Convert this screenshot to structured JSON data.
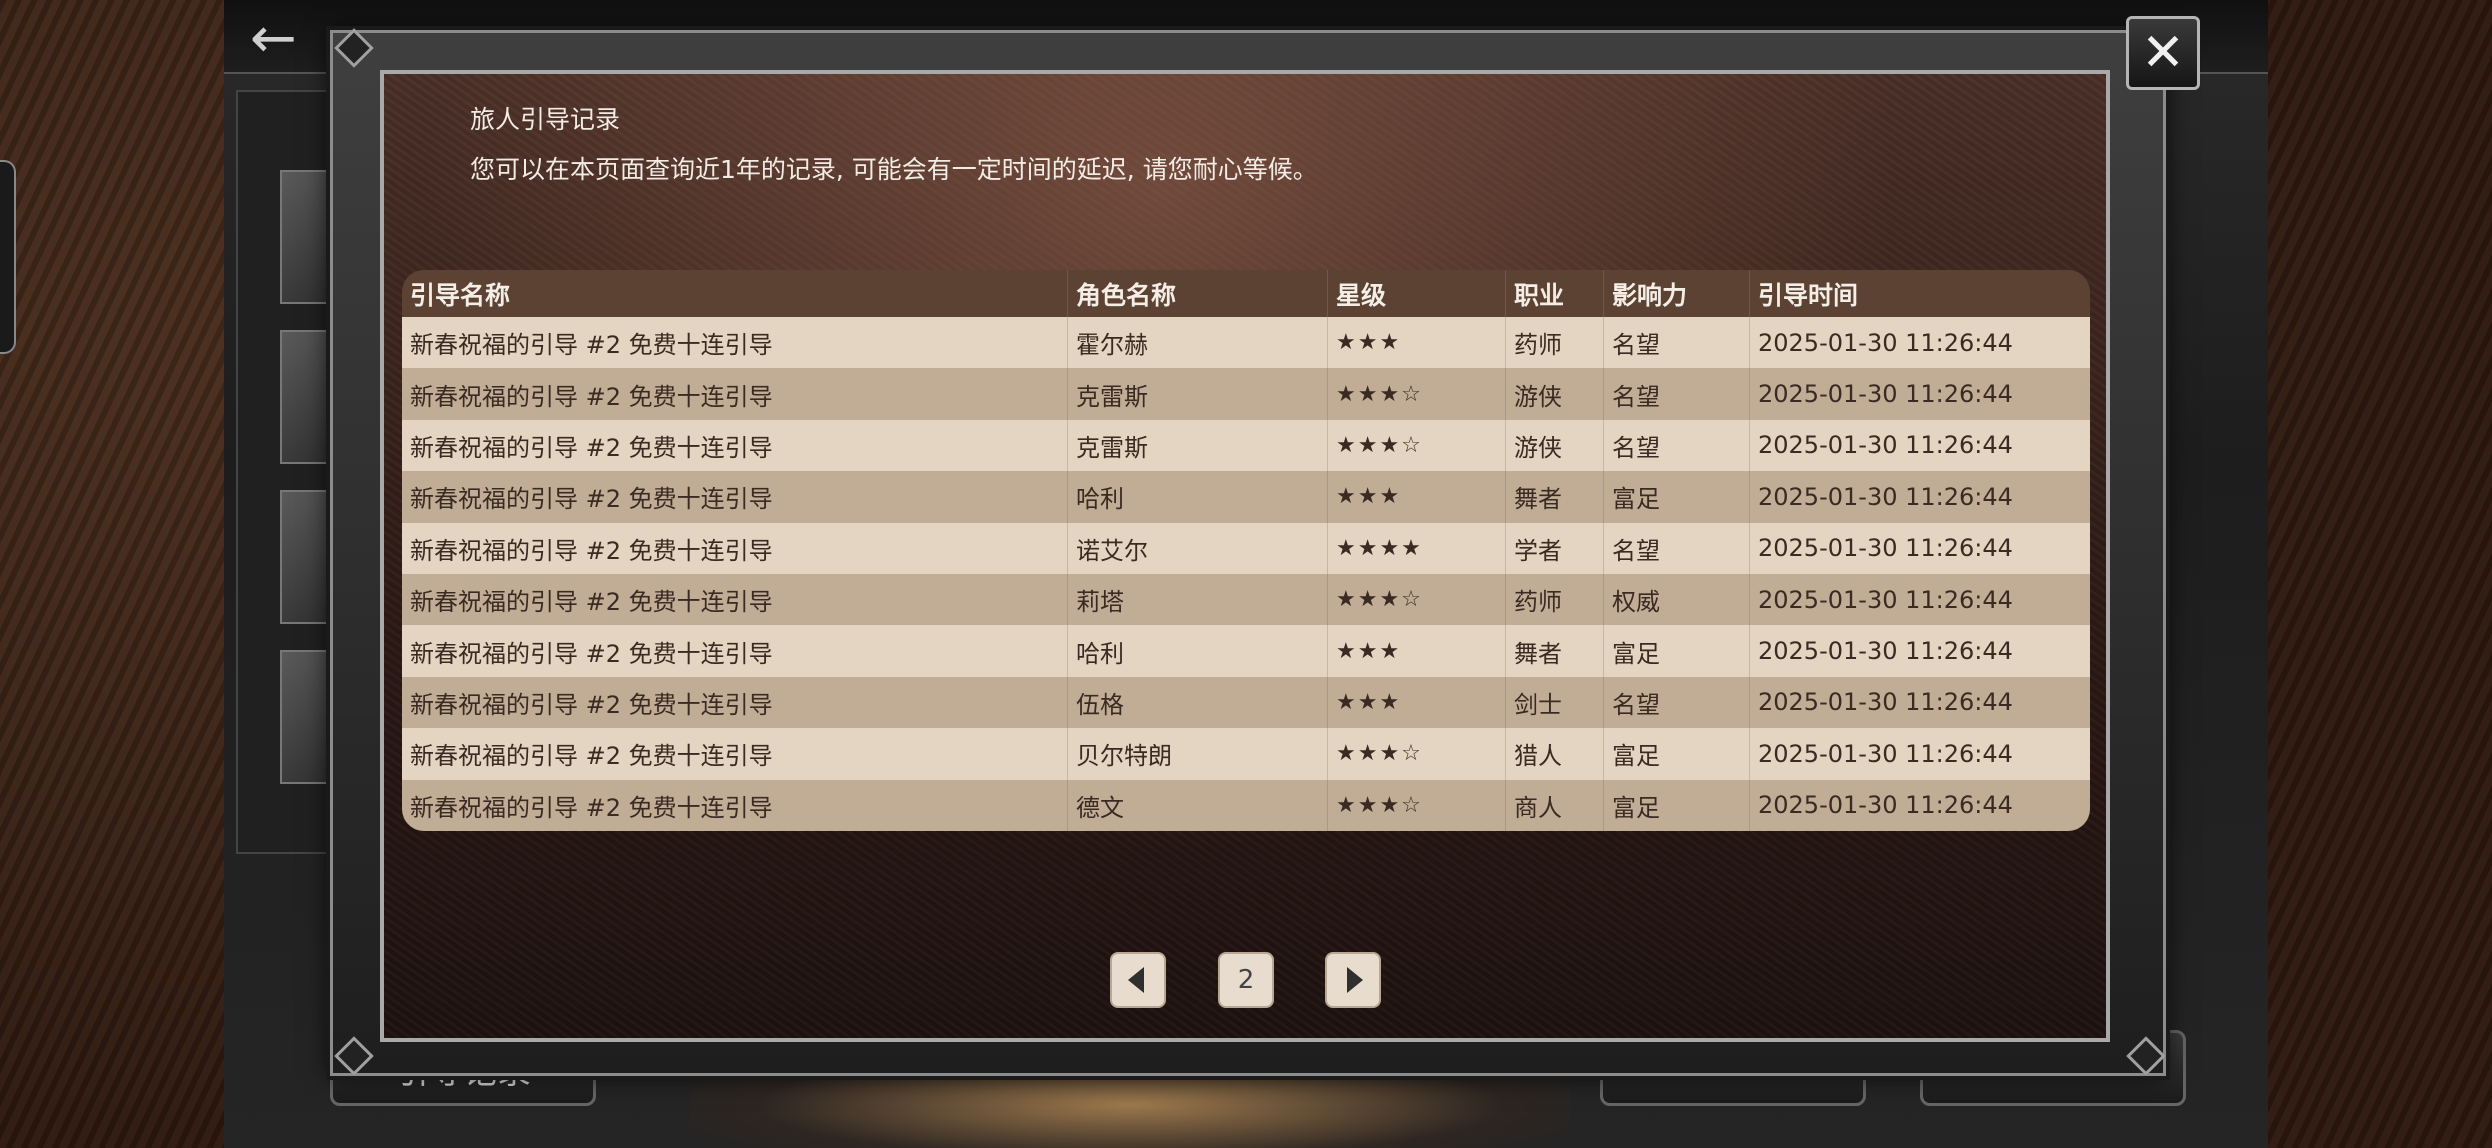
{
  "background": {
    "back_icon": "arrow-left-icon",
    "bottom_left_button": "引导记录"
  },
  "modal": {
    "title": "旅人引导记录",
    "subtitle": "您可以在本页面查询近1年的记录, 可能会有一定时间的延迟, 请您耐心等候。",
    "close_icon": "close-icon",
    "close_symbol": "✕"
  },
  "table": {
    "headers": [
      "引导名称",
      "角色名称",
      "星级",
      "职业",
      "影响力",
      "引导时间"
    ],
    "rows": [
      {
        "name": "新春祝福的引导 #2 免费十连引导",
        "character": "霍尔赫",
        "stars": "★★★",
        "job": "药师",
        "influence": "名望",
        "time": "2025-01-30 11:26:44"
      },
      {
        "name": "新春祝福的引导 #2 免费十连引导",
        "character": "克雷斯",
        "stars": "★★★☆",
        "job": "游侠",
        "influence": "名望",
        "time": "2025-01-30 11:26:44"
      },
      {
        "name": "新春祝福的引导 #2 免费十连引导",
        "character": "克雷斯",
        "stars": "★★★☆",
        "job": "游侠",
        "influence": "名望",
        "time": "2025-01-30 11:26:44"
      },
      {
        "name": "新春祝福的引导 #2 免费十连引导",
        "character": "哈利",
        "stars": "★★★",
        "job": "舞者",
        "influence": "富足",
        "time": "2025-01-30 11:26:44"
      },
      {
        "name": "新春祝福的引导 #2 免费十连引导",
        "character": "诺艾尔",
        "stars": "★★★★",
        "job": "学者",
        "influence": "名望",
        "time": "2025-01-30 11:26:44"
      },
      {
        "name": "新春祝福的引导 #2 免费十连引导",
        "character": "莉塔",
        "stars": "★★★☆",
        "job": "药师",
        "influence": "权威",
        "time": "2025-01-30 11:26:44"
      },
      {
        "name": "新春祝福的引导 #2 免费十连引导",
        "character": "哈利",
        "stars": "★★★",
        "job": "舞者",
        "influence": "富足",
        "time": "2025-01-30 11:26:44"
      },
      {
        "name": "新春祝福的引导 #2 免费十连引导",
        "character": "伍格",
        "stars": "★★★",
        "job": "剑士",
        "influence": "名望",
        "time": "2025-01-30 11:26:44"
      },
      {
        "name": "新春祝福的引导 #2 免费十连引导",
        "character": "贝尔特朗",
        "stars": "★★★☆",
        "job": "猎人",
        "influence": "富足",
        "time": "2025-01-30 11:26:44"
      },
      {
        "name": "新春祝福的引导 #2 免费十连引导",
        "character": "德文",
        "stars": "★★★☆",
        "job": "商人",
        "influence": "富足",
        "time": "2025-01-30 11:26:44"
      }
    ]
  },
  "pagination": {
    "current_page": "2",
    "prev_icon": "triangle-left-icon",
    "next_icon": "triangle-right-icon"
  },
  "colors": {
    "header_bg": "#5b4233",
    "row_light": "#e3d5c1",
    "row_dark": "#c1ad96",
    "text_light": "#f3ece4"
  }
}
